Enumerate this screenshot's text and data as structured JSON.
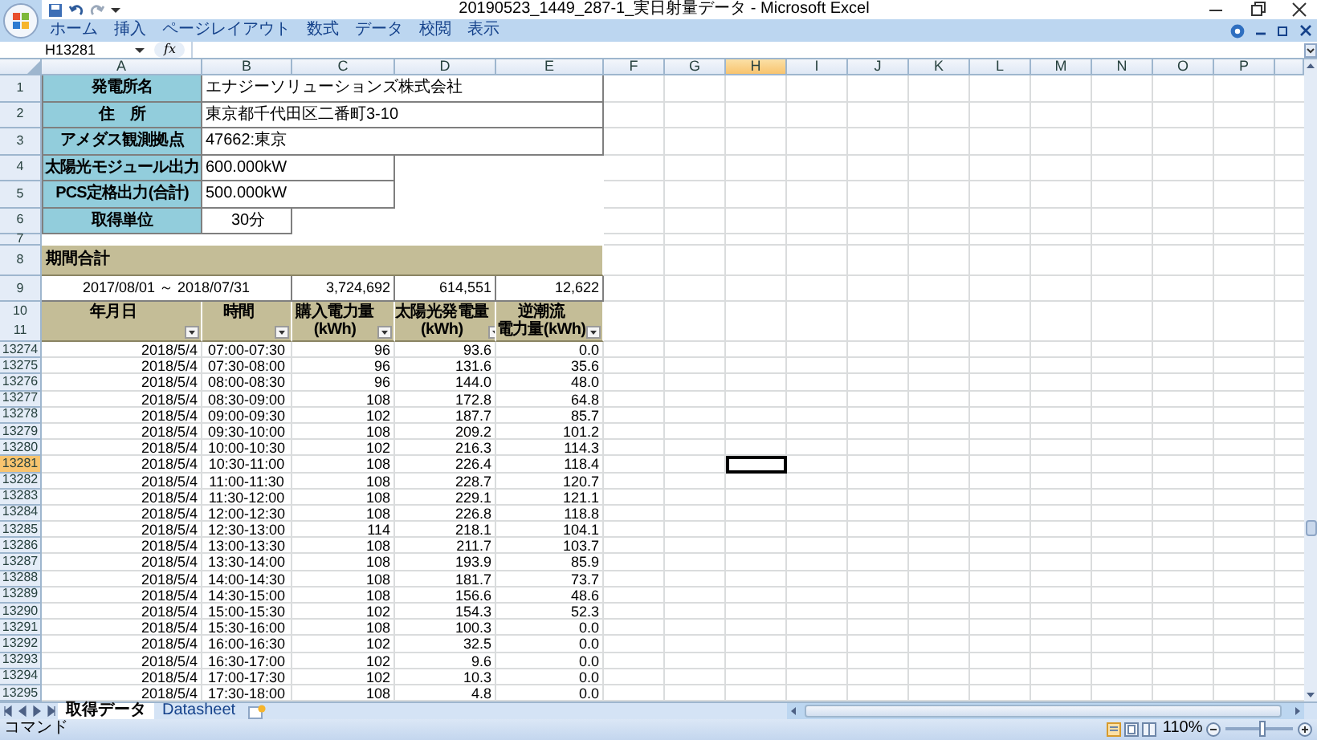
{
  "window": {
    "title": "20190523_1449_287-1_実日射量データ - Microsoft Excel"
  },
  "ribbon_tabs": [
    "ホーム",
    "挿入",
    "ページレイアウト",
    "数式",
    "データ",
    "校閲",
    "表示"
  ],
  "formula_bar": {
    "name_box": "H13281",
    "function_symbol": "fx"
  },
  "columns": [
    {
      "label": "A",
      "selected": false
    },
    {
      "label": "B",
      "selected": false
    },
    {
      "label": "C",
      "selected": false
    },
    {
      "label": "D",
      "selected": false
    },
    {
      "label": "E",
      "selected": false
    },
    {
      "label": "F",
      "selected": false
    },
    {
      "label": "G",
      "selected": false
    },
    {
      "label": "H",
      "selected": true
    },
    {
      "label": "I",
      "selected": false
    },
    {
      "label": "J",
      "selected": false
    },
    {
      "label": "K",
      "selected": false
    },
    {
      "label": "L",
      "selected": false
    },
    {
      "label": "M",
      "selected": false
    },
    {
      "label": "N",
      "selected": false
    },
    {
      "label": "O",
      "selected": false
    },
    {
      "label": "P",
      "selected": false
    }
  ],
  "info_rows": [
    {
      "row": "1",
      "label": "発電所名",
      "value": "エナジーソリューションズ株式会社",
      "kind": "wide"
    },
    {
      "row": "2",
      "label": "住　所",
      "value": "東京都千代田区二番町3-10",
      "kind": "wide"
    },
    {
      "row": "3",
      "label": "アメダス観測拠点",
      "value": "47662:東京",
      "kind": "wide"
    },
    {
      "row": "4",
      "label": "太陽光モジュール出力",
      "value": "600.000kW",
      "kind": "medium"
    },
    {
      "row": "5",
      "label": "PCS定格出力(合計)",
      "value": "500.000kW",
      "kind": "medium"
    },
    {
      "row": "6",
      "label": "取得単位",
      "value": "30分",
      "kind": "narrow"
    }
  ],
  "spacer_row": "7",
  "period": {
    "row": "8",
    "title": "期間合計"
  },
  "totals": {
    "row": "9",
    "range": "2017/08/01 ～ 2018/07/31",
    "values": [
      "3,724,692",
      "614,551",
      "12,622"
    ]
  },
  "table_header": {
    "rows": [
      "10",
      "11"
    ],
    "columns": [
      {
        "lines": [
          "年月日"
        ]
      },
      {
        "lines": [
          "時間"
        ]
      },
      {
        "lines": [
          "購入電力量",
          "(kWh)"
        ]
      },
      {
        "lines": [
          "太陽光発電量",
          "(kWh)"
        ]
      },
      {
        "lines": [
          "逆潮流",
          "電力量(kWh)"
        ]
      }
    ]
  },
  "data_rows": [
    {
      "row": "13274",
      "selected": false,
      "cells": [
        "2018/5/4",
        "07:00-07:30",
        "96",
        "93.6",
        "0.0"
      ]
    },
    {
      "row": "13275",
      "selected": false,
      "cells": [
        "2018/5/4",
        "07:30-08:00",
        "96",
        "131.6",
        "35.6"
      ]
    },
    {
      "row": "13276",
      "selected": false,
      "cells": [
        "2018/5/4",
        "08:00-08:30",
        "96",
        "144.0",
        "48.0"
      ]
    },
    {
      "row": "13277",
      "selected": false,
      "cells": [
        "2018/5/4",
        "08:30-09:00",
        "108",
        "172.8",
        "64.8"
      ]
    },
    {
      "row": "13278",
      "selected": false,
      "cells": [
        "2018/5/4",
        "09:00-09:30",
        "102",
        "187.7",
        "85.7"
      ]
    },
    {
      "row": "13279",
      "selected": false,
      "cells": [
        "2018/5/4",
        "09:30-10:00",
        "108",
        "209.2",
        "101.2"
      ]
    },
    {
      "row": "13280",
      "selected": false,
      "cells": [
        "2018/5/4",
        "10:00-10:30",
        "102",
        "216.3",
        "114.3"
      ]
    },
    {
      "row": "13281",
      "selected": true,
      "cells": [
        "2018/5/4",
        "10:30-11:00",
        "108",
        "226.4",
        "118.4"
      ]
    },
    {
      "row": "13282",
      "selected": false,
      "cells": [
        "2018/5/4",
        "11:00-11:30",
        "108",
        "228.7",
        "120.7"
      ]
    },
    {
      "row": "13283",
      "selected": false,
      "cells": [
        "2018/5/4",
        "11:30-12:00",
        "108",
        "229.1",
        "121.1"
      ]
    },
    {
      "row": "13284",
      "selected": false,
      "cells": [
        "2018/5/4",
        "12:00-12:30",
        "108",
        "226.8",
        "118.8"
      ]
    },
    {
      "row": "13285",
      "selected": false,
      "cells": [
        "2018/5/4",
        "12:30-13:00",
        "114",
        "218.1",
        "104.1"
      ]
    },
    {
      "row": "13286",
      "selected": false,
      "cells": [
        "2018/5/4",
        "13:00-13:30",
        "108",
        "211.7",
        "103.7"
      ]
    },
    {
      "row": "13287",
      "selected": false,
      "cells": [
        "2018/5/4",
        "13:30-14:00",
        "108",
        "193.9",
        "85.9"
      ]
    },
    {
      "row": "13288",
      "selected": false,
      "cells": [
        "2018/5/4",
        "14:00-14:30",
        "108",
        "181.7",
        "73.7"
      ]
    },
    {
      "row": "13289",
      "selected": false,
      "cells": [
        "2018/5/4",
        "14:30-15:00",
        "108",
        "156.6",
        "48.6"
      ]
    },
    {
      "row": "13290",
      "selected": false,
      "cells": [
        "2018/5/4",
        "15:00-15:30",
        "102",
        "154.3",
        "52.3"
      ]
    },
    {
      "row": "13291",
      "selected": false,
      "cells": [
        "2018/5/4",
        "15:30-16:00",
        "108",
        "100.3",
        "0.0"
      ]
    },
    {
      "row": "13292",
      "selected": false,
      "cells": [
        "2018/5/4",
        "16:00-16:30",
        "102",
        "32.5",
        "0.0"
      ]
    },
    {
      "row": "13293",
      "selected": false,
      "cells": [
        "2018/5/4",
        "16:30-17:00",
        "102",
        "9.6",
        "0.0"
      ]
    },
    {
      "row": "13294",
      "selected": false,
      "cells": [
        "2018/5/4",
        "17:00-17:30",
        "102",
        "10.3",
        "0.0"
      ]
    },
    {
      "row": "13295",
      "selected": false,
      "cells": [
        "2018/5/4",
        "17:30-18:00",
        "108",
        "4.8",
        "0.0"
      ]
    }
  ],
  "sheet_tabs": [
    {
      "label": "取得データ",
      "selected": true
    },
    {
      "label": "Datasheet",
      "selected": false
    }
  ],
  "status_bar": {
    "mode": "コマンド",
    "zoom": "110%",
    "zoom_slider": {
      "level": 0.55
    }
  }
}
